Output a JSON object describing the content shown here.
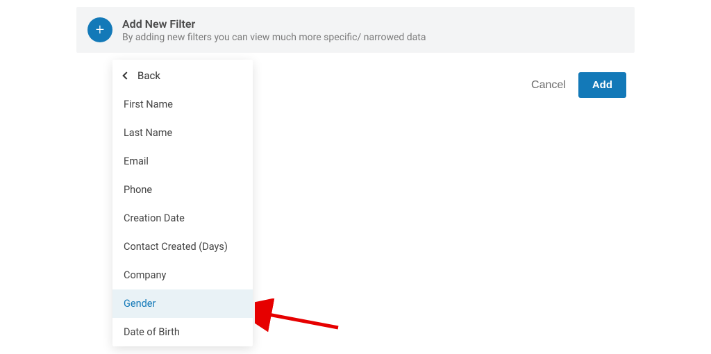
{
  "header": {
    "title": "Add New Filter",
    "subtitle": "By adding new filters you can view much more specific/ narrowed data"
  },
  "actions": {
    "cancel_label": "Cancel",
    "add_label": "Add"
  },
  "dropdown": {
    "back_label": "Back",
    "items": [
      {
        "label": "First Name",
        "selected": false
      },
      {
        "label": "Last Name",
        "selected": false
      },
      {
        "label": "Email",
        "selected": false
      },
      {
        "label": "Phone",
        "selected": false
      },
      {
        "label": "Creation Date",
        "selected": false
      },
      {
        "label": "Contact Created (Days)",
        "selected": false
      },
      {
        "label": "Company",
        "selected": false
      },
      {
        "label": "Gender",
        "selected": true
      },
      {
        "label": "Date of Birth",
        "selected": false
      }
    ]
  },
  "colors": {
    "accent": "#1379b8",
    "header_bg": "#f3f4f5",
    "selected_bg": "#e9f2f6",
    "annotation": "#e60000"
  }
}
